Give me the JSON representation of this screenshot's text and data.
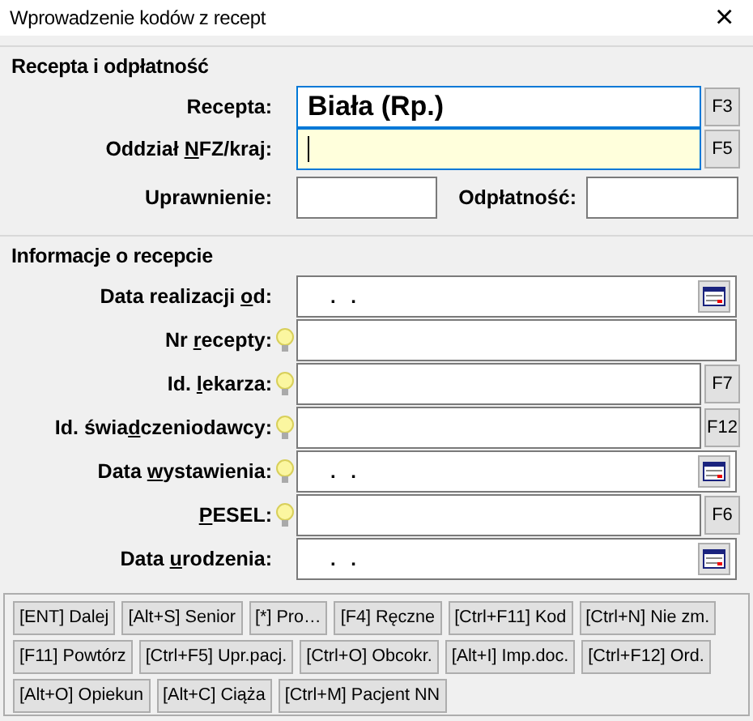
{
  "window": {
    "title": "Wprowadzenie kodów z recept",
    "close": "×"
  },
  "section_1": {
    "title": "Recepta i odpłatność",
    "fields": [
      {
        "label": [
          {
            "text": "Recepta:",
            "accel": false
          }
        ],
        "value": "Biała (Rp.)",
        "focused": false,
        "highlighted": true,
        "button": "F3"
      },
      {
        "label": [
          {
            "text": "Oddział ",
            "accel": false
          },
          {
            "text": "N",
            "accel": true
          },
          {
            "text": "FZ/kraj:",
            "accel": false
          }
        ],
        "focused": true,
        "highlighted": true,
        "button": "F5"
      }
    ],
    "small_fields": [
      {
        "label": "Uprawnienie:"
      },
      {
        "label": "Odpłatność:"
      }
    ]
  },
  "section_2": {
    "title": "Informacje o recepcie",
    "fields": [
      {
        "kind": "date",
        "label": [
          {
            "text": "Data realizacji ",
            "accel": false
          },
          {
            "text": "o",
            "accel": true
          },
          {
            "text": "d:",
            "accel": false
          }
        ],
        "bulb": false,
        "value": ". ."
      },
      {
        "kind": "text",
        "label": [
          {
            "text": "Nr ",
            "accel": false
          },
          {
            "text": "r",
            "accel": true
          },
          {
            "text": "ecepty:",
            "accel": false
          }
        ],
        "bulb": true
      },
      {
        "kind": "text",
        "label": [
          {
            "text": "Id. ",
            "accel": false
          },
          {
            "text": "l",
            "accel": true
          },
          {
            "text": "ekarza:",
            "accel": false
          }
        ],
        "bulb": true,
        "button": "F7"
      },
      {
        "kind": "text",
        "label": [
          {
            "text": "Id. świa",
            "accel": false
          },
          {
            "text": "d",
            "accel": true
          },
          {
            "text": "czeniodawcy:",
            "accel": false
          }
        ],
        "bulb": true,
        "button": "F12"
      },
      {
        "kind": "date",
        "label": [
          {
            "text": "Data ",
            "accel": false
          },
          {
            "text": "w",
            "accel": true
          },
          {
            "text": "ystawienia:",
            "accel": false
          }
        ],
        "bulb": true,
        "value": ". ."
      },
      {
        "kind": "text",
        "label": [
          {
            "text": "P",
            "accel": true
          },
          {
            "text": "ESEL:",
            "accel": false
          }
        ],
        "bulb": true,
        "button": "F6"
      },
      {
        "kind": "date",
        "label": [
          {
            "text": "Data ",
            "accel": false
          },
          {
            "text": "u",
            "accel": true
          },
          {
            "text": "rodzenia:",
            "accel": false
          }
        ],
        "bulb": false,
        "value": ". ."
      }
    ]
  },
  "shortcut_buttons": [
    [
      "[ENT] Dalej",
      "[Alt+S] Senior",
      "[*] Pro…",
      "[F4] Ręczne",
      "[Ctrl+F11] Kod",
      "[Ctrl+N] Nie zm."
    ],
    [
      "[F11] Powtórz",
      "[Ctrl+F5] Upr.pacj.",
      "[Ctrl+O] Obcokr.",
      "[Alt+I] Imp.doc.",
      "[Ctrl+F12] Ord."
    ],
    [
      "[Alt+O] Opiekun",
      "[Alt+C] Ciąża",
      "[Ctrl+M] Pacjent NN"
    ]
  ]
}
